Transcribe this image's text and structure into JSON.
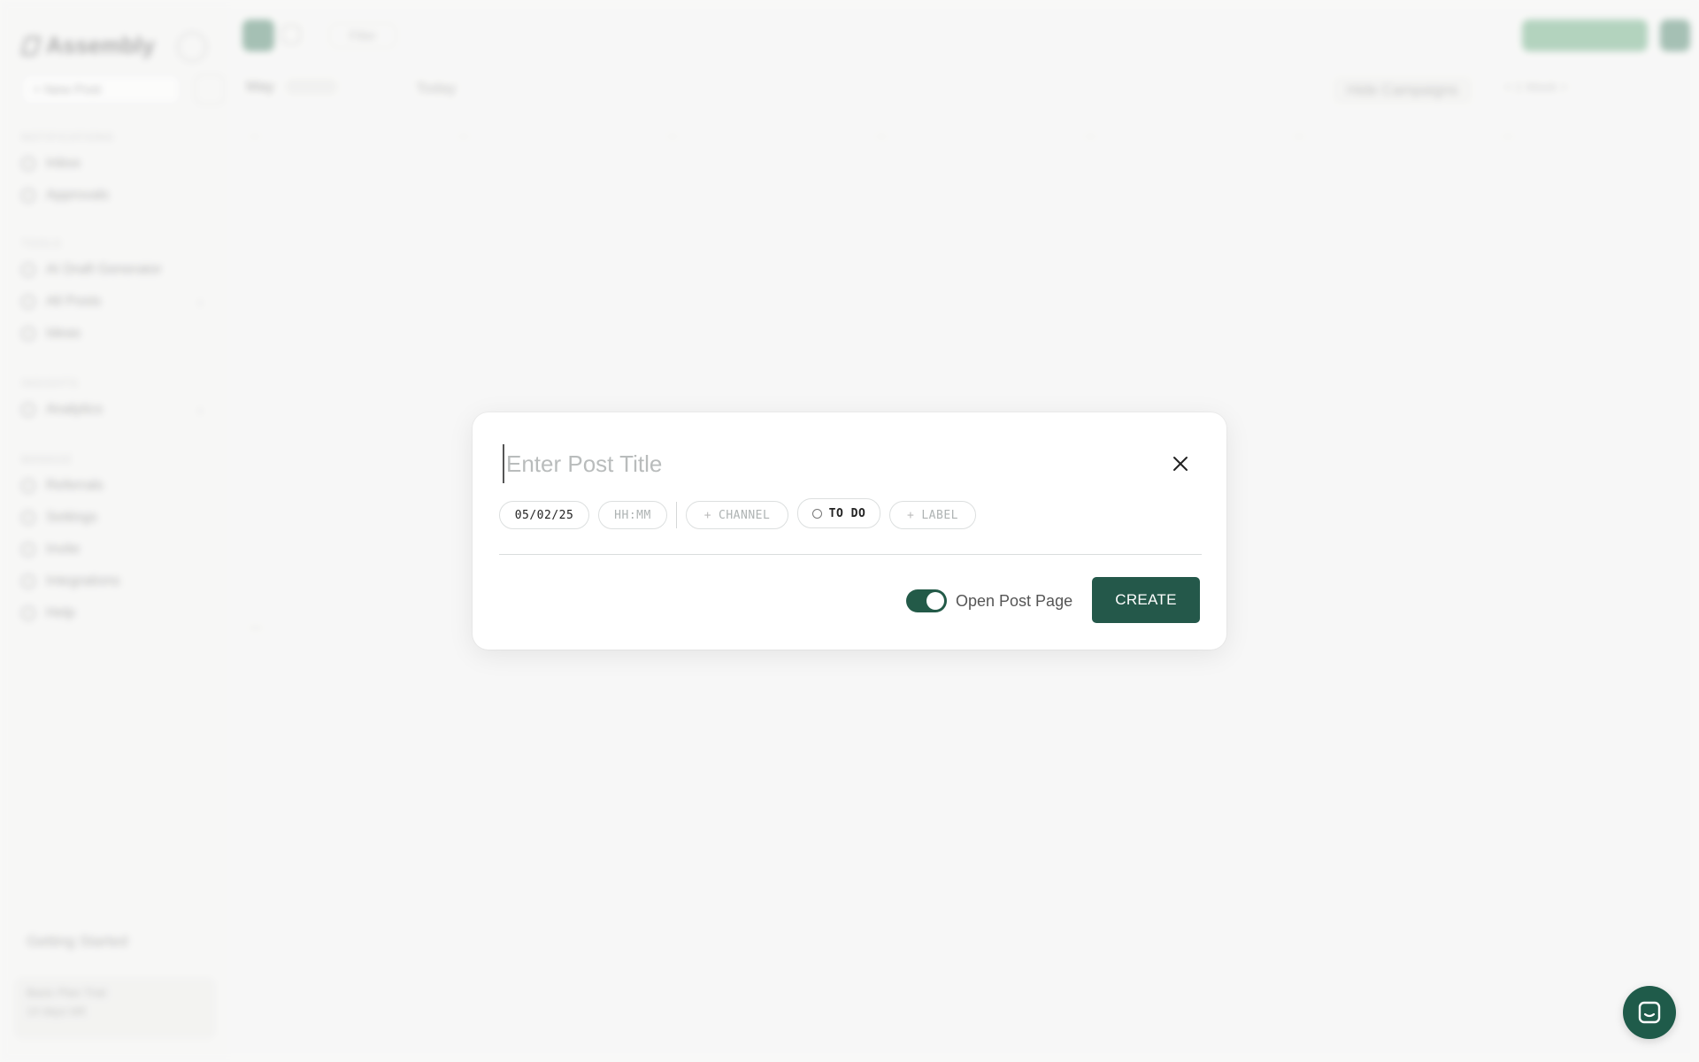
{
  "background": {
    "brand_name": "Assembly",
    "new_post_label": "+ New Post",
    "sections": {
      "inbox": "Notifications",
      "tools": "Tools",
      "insights": "Insights",
      "manage": "Manage"
    },
    "nav_items": {
      "inbox": "Inbox",
      "approvals": "Approvals",
      "ai_draft": "AI Draft Generator",
      "all_posts": "All Posts",
      "ideas": "Ideas",
      "analytics": "Analytics",
      "referrals": "Referrals",
      "settings": "Settings",
      "invite": "Invite",
      "integrations": "Integrations",
      "help": "Help"
    },
    "getting_started": "Getting Started",
    "plan_title": "Basic Plan Trial",
    "plan_subtitle": "14 days left",
    "filter_label": "Filter",
    "month_label": "May",
    "today_label": "Today",
    "hide_campaigns_label": "Hide Campaigns",
    "week_control": "< 1 Week >"
  },
  "modal": {
    "title_placeholder": "Enter Post Title",
    "title_value": "",
    "date_value": "05/02/25",
    "time_placeholder": "HH:MM",
    "channel_label": "CHANNEL",
    "status_label": "TO DO",
    "label_label": "LABEL",
    "toggle_label": "Open Post Page",
    "toggle_on": true,
    "create_label": "CREATE"
  },
  "colors": {
    "primary": "#24584a",
    "accent_green": "#4f9c6c",
    "chip_border": "#dcdfdf"
  },
  "icons": {
    "close": "close-icon",
    "chat": "chat-icon",
    "plus": "plus-icon",
    "status_circle": "circle-icon"
  }
}
